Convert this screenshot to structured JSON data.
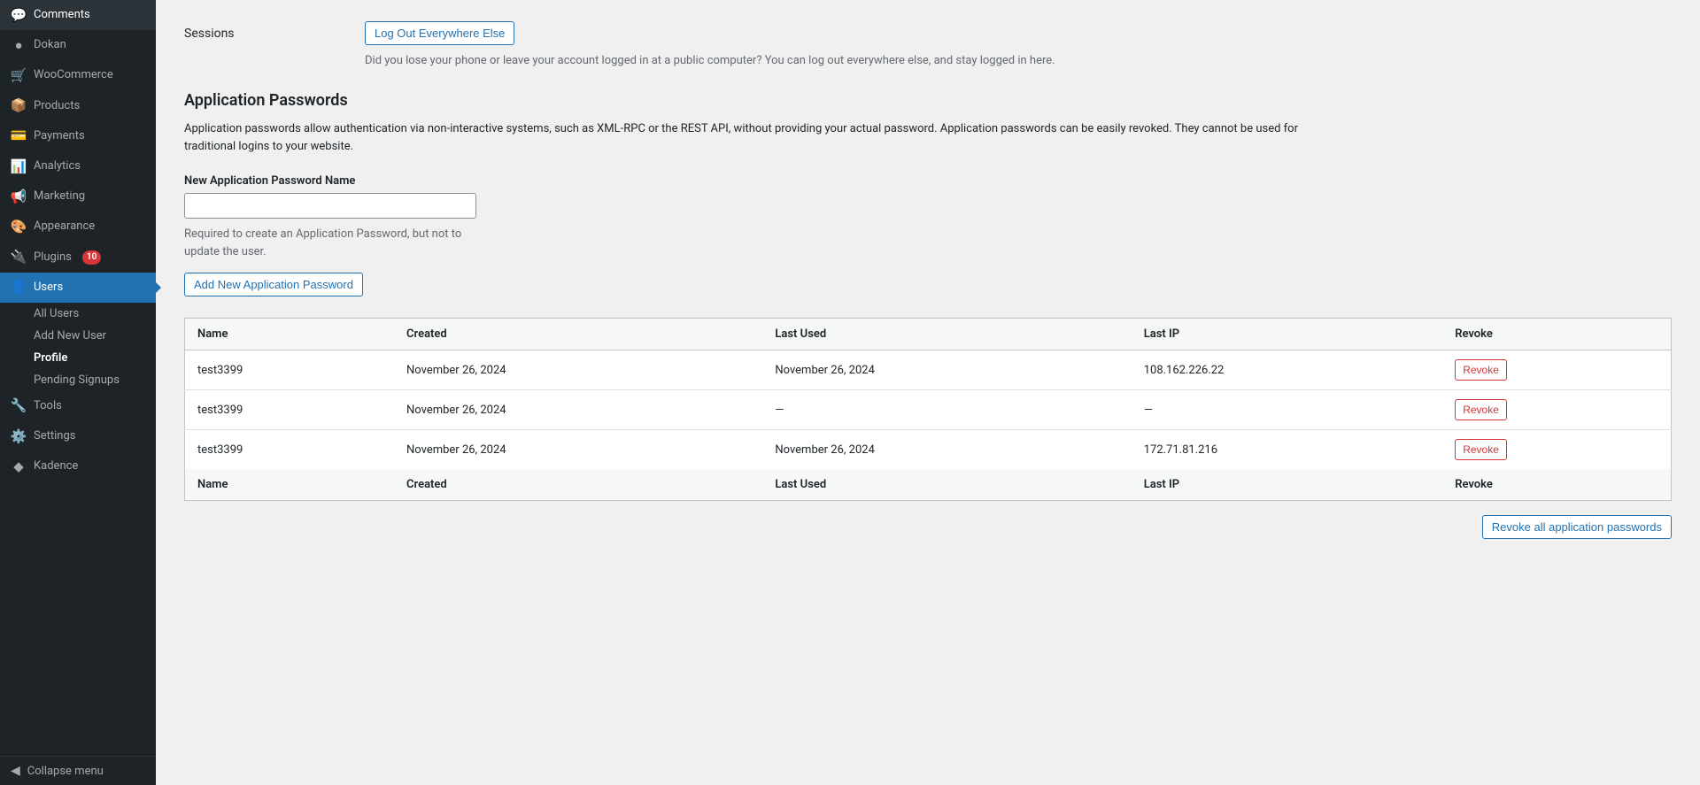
{
  "sidebar": {
    "items": [
      {
        "id": "comments",
        "label": "Comments",
        "icon": "💬",
        "active": false
      },
      {
        "id": "dokan",
        "label": "Dokan",
        "icon": "●",
        "active": false
      },
      {
        "id": "woocommerce",
        "label": "WooCommerce",
        "icon": "🛒",
        "active": false
      },
      {
        "id": "products",
        "label": "Products",
        "icon": "📦",
        "active": false
      },
      {
        "id": "payments",
        "label": "Payments",
        "icon": "💳",
        "active": false
      },
      {
        "id": "analytics",
        "label": "Analytics",
        "icon": "📊",
        "active": false
      },
      {
        "id": "marketing",
        "label": "Marketing",
        "icon": "📢",
        "active": false
      },
      {
        "id": "appearance",
        "label": "Appearance",
        "icon": "🎨",
        "active": false
      },
      {
        "id": "plugins",
        "label": "Plugins",
        "icon": "🔌",
        "badge": "10",
        "active": false
      },
      {
        "id": "users",
        "label": "Users",
        "icon": "👤",
        "active": true
      },
      {
        "id": "tools",
        "label": "Tools",
        "icon": "🔧",
        "active": false
      },
      {
        "id": "settings",
        "label": "Settings",
        "icon": "⚙️",
        "active": false
      },
      {
        "id": "kadence",
        "label": "Kadence",
        "icon": "◆",
        "active": false
      }
    ],
    "submenu": [
      {
        "id": "all-users",
        "label": "All Users",
        "active": false
      },
      {
        "id": "add-new-user",
        "label": "Add New User",
        "active": false
      },
      {
        "id": "profile",
        "label": "Profile",
        "active": true
      },
      {
        "id": "pending-signups",
        "label": "Pending Signups",
        "active": false
      }
    ],
    "collapse_label": "Collapse menu"
  },
  "sessions": {
    "label": "Sessions",
    "button_label": "Log Out Everywhere Else",
    "description": "Did you lose your phone or leave your account logged in at a public computer? You can log out everywhere else, and stay logged in here."
  },
  "app_passwords": {
    "title": "Application Passwords",
    "description": "Application passwords allow authentication via non-interactive systems, such as XML-RPC or the REST API, without providing your actual password. Application passwords can be easily revoked. They cannot be used for traditional logins to your website.",
    "field_label": "New Application Password Name",
    "field_placeholder": "",
    "field_hint": "Required to create an Application Password, but not to update the user.",
    "add_button_label": "Add New Application Password",
    "table": {
      "headers": [
        "Name",
        "Created",
        "Last Used",
        "Last IP",
        "Revoke"
      ],
      "rows": [
        {
          "name": "test3399",
          "created": "November 26, 2024",
          "last_used": "November 26, 2024",
          "last_ip": "108.162.226.22",
          "has_used": true
        },
        {
          "name": "test3399",
          "created": "November 26, 2024",
          "last_used": "—",
          "last_ip": "—",
          "has_used": false
        },
        {
          "name": "test3399",
          "created": "November 26, 2024",
          "last_used": "November 26, 2024",
          "last_ip": "172.71.81.216",
          "has_used": true
        }
      ],
      "footer_headers": [
        "Name",
        "Created",
        "Last Used",
        "Last IP",
        "Revoke"
      ],
      "revoke_label": "Revoke"
    },
    "revoke_all_label": "Revoke all application passwords"
  }
}
